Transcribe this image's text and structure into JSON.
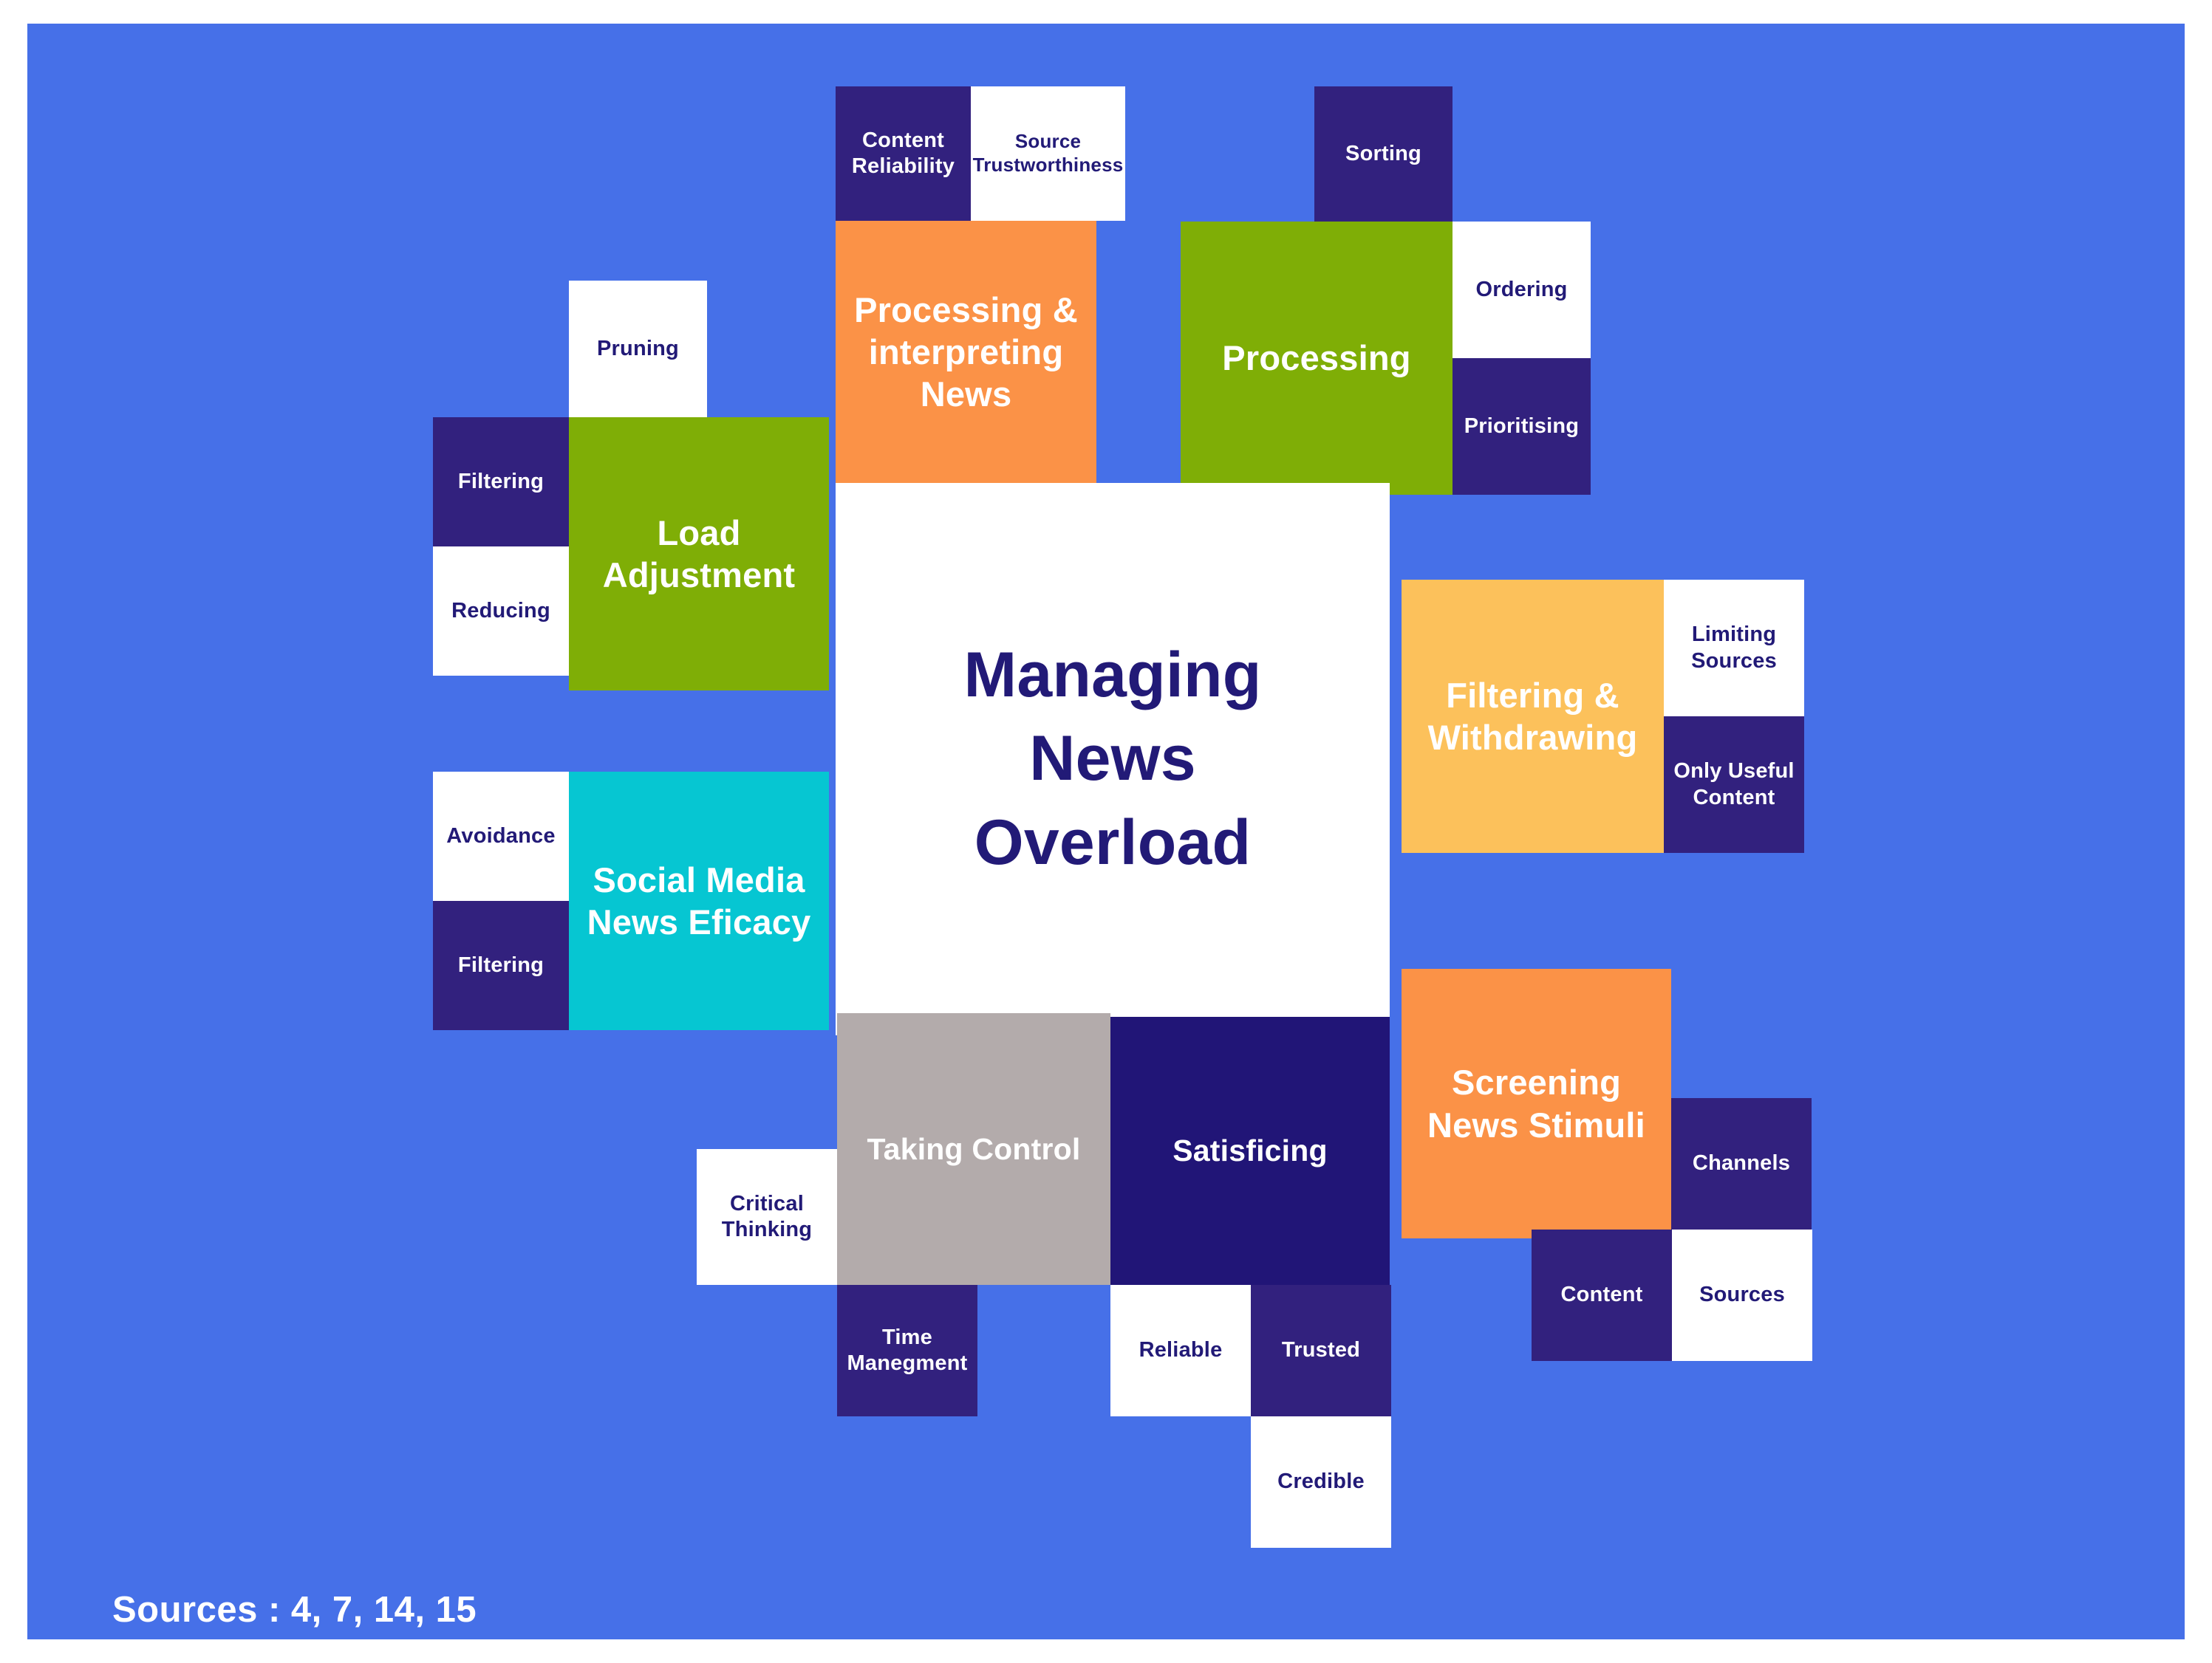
{
  "board": {
    "background_color": "#4670E8",
    "frame_color": "#ffffff"
  },
  "center": {
    "title_line1": "Managing",
    "title_line2": "News",
    "title_line3": "Overload",
    "color": "#221A77",
    "background": "#ffffff"
  },
  "footer": {
    "sources_label": "Sources : 4, 7, 14, 15"
  },
  "palette": {
    "background_blue": "#4670E8",
    "purple": "#32217E",
    "navy": "#211577",
    "orange": "#FB9247",
    "green": "#7FAE06",
    "amber": "#FCC15B",
    "teal": "#06C6D2",
    "grey": "#B3ABAB",
    "white": "#ffffff"
  },
  "clusters": [
    {
      "id": "processing-interpreting-news",
      "main": "Processing & interpreting News",
      "main_color": "#FB9247",
      "children": [
        "Content Reliability",
        "Source Trustworthiness"
      ]
    },
    {
      "id": "processing",
      "main": "Processing",
      "main_color": "#7FAE06",
      "children": [
        "Sorting",
        "Ordering",
        "Prioritising"
      ]
    },
    {
      "id": "load-adjustment",
      "main": "Load Adjustment",
      "main_color": "#7FAE06",
      "children": [
        "Pruning",
        "Filtering",
        "Reducing"
      ]
    },
    {
      "id": "filtering-withdrawing",
      "main": "Filtering & Withdrawing",
      "main_color": "#FCC15B",
      "children": [
        "Limiting Sources",
        "Only Useful Content"
      ]
    },
    {
      "id": "social-media-news-eficacy",
      "main": "Social Media News Eficacy",
      "main_color": "#06C6D2",
      "children": [
        "Avoidance",
        "Filtering"
      ]
    },
    {
      "id": "taking-control",
      "main": "Taking Control",
      "main_color": "#B3ABAB",
      "children": [
        "Critical Thinking",
        "Time Manegment"
      ]
    },
    {
      "id": "satisficing",
      "main": "Satisficing",
      "main_color": "#211577",
      "children": [
        "Reliable",
        "Trusted",
        "Credible"
      ]
    },
    {
      "id": "screening-news-stimuli",
      "main": "Screening News Stimuli",
      "main_color": "#FB9247",
      "children": [
        "Channels",
        "Content",
        "Sources"
      ]
    }
  ],
  "tiles": {
    "content_reliability": "Content Reliability",
    "source_trustworthiness": "Source Trustworthiness",
    "processing_interpreting_news": "Processing & interpreting News",
    "sorting": "Sorting",
    "processing": "Processing",
    "ordering": "Ordering",
    "prioritising": "Prioritising",
    "pruning": "Pruning",
    "filtering_left": "Filtering",
    "reducing": "Reducing",
    "load_adjustment": "Load Adjustment",
    "avoidance": "Avoidance",
    "filtering_social": "Filtering",
    "social_media_news_eficacy": "Social Media News Eficacy",
    "filtering_withdrawing": "Filtering & Withdrawing",
    "limiting_sources": "Limiting Sources",
    "only_useful_content": "Only Useful Content",
    "screening_news_stimuli": "Screening News Stimuli",
    "channels": "Channels",
    "content": "Content",
    "sources_tile": "Sources",
    "critical_thinking": "Critical Thinking",
    "taking_control": "Taking Control",
    "time_manegment": "Time Manegment",
    "satisficing": "Satisficing",
    "reliable": "Reliable",
    "trusted": "Trusted",
    "credible": "Credible"
  }
}
